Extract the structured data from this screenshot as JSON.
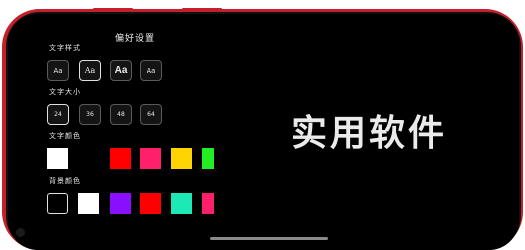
{
  "panel": {
    "title": "偏好设置"
  },
  "text_style": {
    "label": "文字样式",
    "options": [
      {
        "label": "Aa",
        "selected": false
      },
      {
        "label": "Aa",
        "selected": true
      },
      {
        "label": "Aa",
        "selected": false
      },
      {
        "label": "Aa",
        "selected": false
      }
    ]
  },
  "text_size": {
    "label": "文字大小",
    "options": [
      {
        "label": "24",
        "selected": true
      },
      {
        "label": "36",
        "selected": false
      },
      {
        "label": "48",
        "selected": false
      },
      {
        "label": "64",
        "selected": false
      }
    ]
  },
  "text_color": {
    "label": "文字颜色",
    "swatches": [
      "#ffffff",
      "#000000",
      "#ff0000",
      "#ff1f6b",
      "#ffd400",
      "#22ee22"
    ]
  },
  "background_color": {
    "label": "背景颜色",
    "swatches": [
      "#000000",
      "#ffffff",
      "#8a0fff",
      "#ff0000",
      "#1de9b6",
      "#ff1f6b"
    ]
  },
  "watermark": {
    "text": "实用软件"
  },
  "colors": {
    "frame": "#c61f2c",
    "screen": "#000000"
  }
}
